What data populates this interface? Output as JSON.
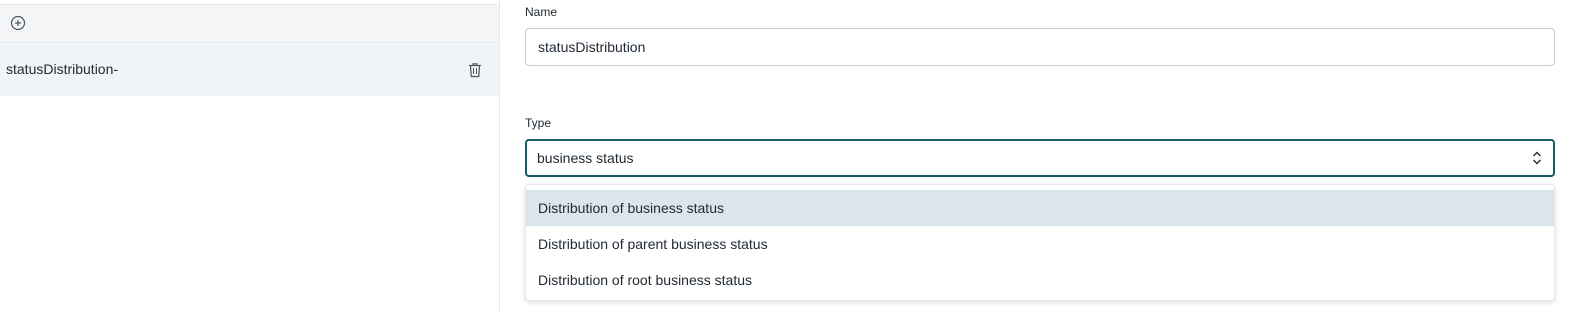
{
  "left_panel": {
    "add_icon": "plus-circle-icon",
    "items": [
      {
        "label": "statusDistribution-",
        "delete_icon": "trash-icon"
      }
    ]
  },
  "form": {
    "name": {
      "label": "Name",
      "value": "statusDistribution"
    },
    "type": {
      "label": "Type",
      "search_value": "business status",
      "chevron_icon": "chevron-up-down-icon",
      "options": [
        {
          "label": "Distribution of business status",
          "highlighted": true
        },
        {
          "label": "Distribution of parent business status",
          "highlighted": false
        },
        {
          "label": "Distribution of root business status",
          "highlighted": false
        }
      ]
    }
  },
  "colors": {
    "focus_border": "#1c5a66",
    "highlight_bg": "#dbe6ec",
    "selected_item_bg": "#f1f4f7",
    "toolbar_bg": "#f4f5f7"
  }
}
